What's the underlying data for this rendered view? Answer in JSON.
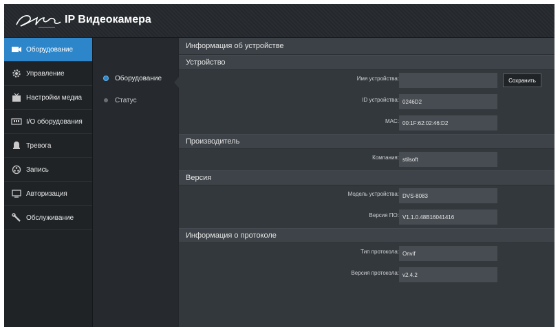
{
  "app": {
    "title": "IP Видеокамера"
  },
  "colors": {
    "accent": "#2d86c9",
    "background": "#23272b",
    "panel": "#33383d"
  },
  "sidebar": {
    "items": [
      {
        "label": "Оборудование",
        "icon": "camera-icon",
        "active": true
      },
      {
        "label": "Управление",
        "icon": "gear-icon",
        "active": false
      },
      {
        "label": "Настройки медиа",
        "icon": "media-settings-icon",
        "active": false
      },
      {
        "label": "I/O оборудования",
        "icon": "io-port-icon",
        "active": false
      },
      {
        "label": "Тревога",
        "icon": "alarm-icon",
        "active": false
      },
      {
        "label": "Запись",
        "icon": "record-icon",
        "active": false
      },
      {
        "label": "Авторизация",
        "icon": "monitor-icon",
        "active": false
      },
      {
        "label": "Обслуживание",
        "icon": "wrench-icon",
        "active": false
      }
    ]
  },
  "subnav": {
    "items": [
      {
        "label": "Оборудование",
        "active": true
      },
      {
        "label": "Статус",
        "active": false
      }
    ]
  },
  "main": {
    "title": "Информация об устройстве",
    "sections": {
      "device": {
        "title": "Устройство",
        "fields": {
          "name": {
            "label": "Имя устройства:",
            "value": ""
          },
          "id": {
            "label": "ID устройства:",
            "value": "0246D2"
          },
          "mac": {
            "label": "MAC:",
            "value": "00:1F:62:02:46:D2"
          }
        },
        "save_label": "Сохранить"
      },
      "manufacturer": {
        "title": "Производитель",
        "fields": {
          "company": {
            "label": "Компания:",
            "value": "stilsoft"
          }
        }
      },
      "version": {
        "title": "Версия",
        "fields": {
          "model": {
            "label": "Модель устройства:",
            "value": "DVS-8083"
          },
          "firmware": {
            "label": "Версия ПО:",
            "value": "V1.1.0.48B16041416"
          }
        }
      },
      "protocol": {
        "title": "Информация о протоколе",
        "fields": {
          "type": {
            "label": "Тип протокола:",
            "value": "Onvif"
          },
          "version": {
            "label": "Версия протокола:",
            "value": "v2.4.2"
          }
        }
      }
    }
  }
}
